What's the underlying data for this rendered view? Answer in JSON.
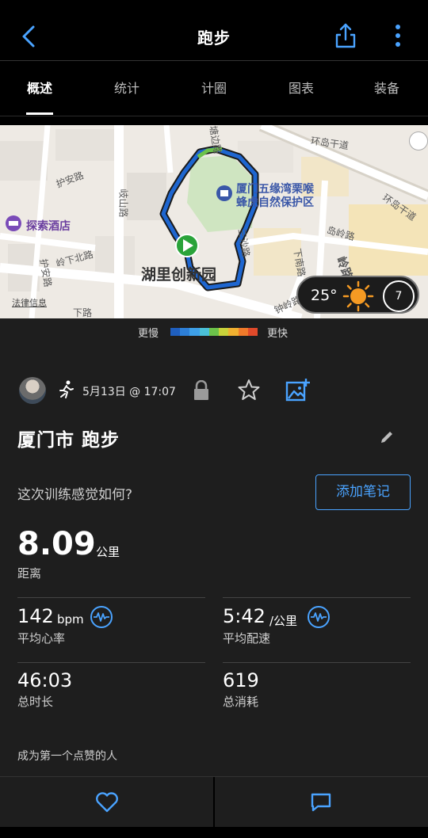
{
  "header": {
    "title": "跑步"
  },
  "tabs": [
    {
      "label": "概述",
      "active": true
    },
    {
      "label": "统计",
      "active": false
    },
    {
      "label": "计圈",
      "active": false
    },
    {
      "label": "图表",
      "active": false
    },
    {
      "label": "装备",
      "active": false
    }
  ],
  "map": {
    "labels": {
      "huanDao1": "环岛干道",
      "huanDao2": "环岛干道",
      "huAn": "护安路",
      "qiShan": "岐山路",
      "lingXiaBei": "岭下北路",
      "huAn2": "护安路",
      "xiaRoad": "下路",
      "poi_reserve_line1": "厦门五缘湾栗喉",
      "poi_reserve_line2": "蜂虎自然保护区",
      "hotel": "探索酒店",
      "district": "湖里创新园",
      "legal": "法律信息",
      "zhongLing": "钟岭路",
      "lingYue": "岭路",
      "xiaNan": "下南路",
      "tangBian": "塘边路",
      "daoLing": "岛岭路",
      "sanSha": "三沙路"
    },
    "weather": {
      "temperature": "25°",
      "wind_speed": "7",
      "icon": "sun-icon"
    }
  },
  "pace_legend": {
    "slower": "更慢",
    "faster": "更快",
    "colors": [
      "#1f5fbf",
      "#2d7fd8",
      "#3ea0e8",
      "#4ac0d8",
      "#6cc24a",
      "#c8d23a",
      "#f0b030",
      "#f07a2a",
      "#e04a2a"
    ]
  },
  "activity": {
    "datetime": "5月13日 @ 17:07",
    "name": "厦门市 跑步",
    "feel_question": "这次训练感觉如何?",
    "add_note": "添加笔记",
    "distance": {
      "value": "8.09",
      "unit": "公里",
      "label": "距离"
    },
    "stats": {
      "heart_rate": {
        "value": "142",
        "unit": "bpm",
        "label": "平均心率"
      },
      "pace": {
        "value": "5:42",
        "unit": "/公里",
        "label": "平均配速"
      },
      "duration": {
        "value": "46:03",
        "label": "总时长"
      },
      "calories": {
        "value": "619",
        "label": "总消耗"
      }
    },
    "likes_text": "成为第一个点赞的人"
  },
  "colors": {
    "accent": "#4aa3ff",
    "background": "#1e1e1e",
    "route": "#1e66d0"
  }
}
